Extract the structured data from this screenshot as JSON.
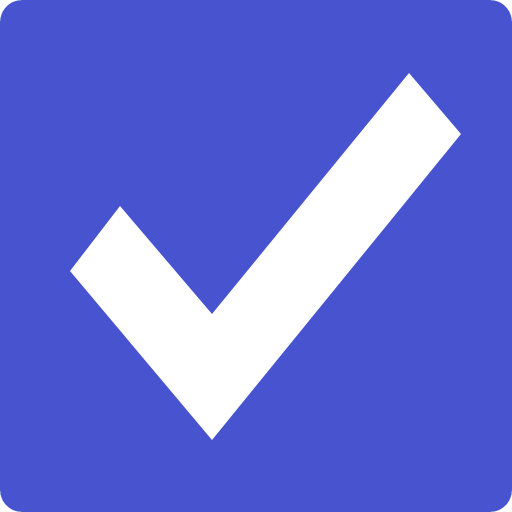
{
  "checkbox": {
    "state": "checked",
    "icon": "check-icon",
    "colors": {
      "background": "#4753CF",
      "checkmark": "#FFFFFF"
    }
  }
}
